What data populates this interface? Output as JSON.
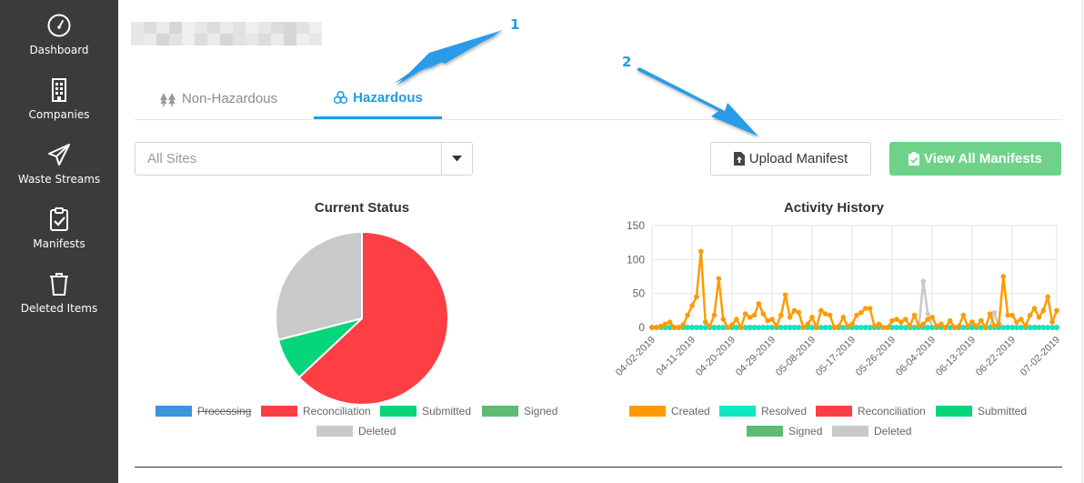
{
  "sidebar": {
    "items": [
      {
        "label": "Dashboard",
        "icon": "dashboard-gauge-icon"
      },
      {
        "label": "Companies",
        "icon": "building-icon"
      },
      {
        "label": "Waste Streams",
        "icon": "paper-plane-icon"
      },
      {
        "label": "Manifests",
        "icon": "clipboard-check-icon"
      },
      {
        "label": "Deleted Items",
        "icon": "trash-icon"
      }
    ]
  },
  "tabs": [
    {
      "label": "Non-Hazardous",
      "icon": "trees-icon",
      "active": false
    },
    {
      "label": "Hazardous",
      "icon": "biohazard-icon",
      "active": true
    }
  ],
  "site_filter": {
    "value": "All Sites"
  },
  "buttons": {
    "upload_label": "Upload Manifest",
    "view_all_label": "View All Manifests"
  },
  "annotations": {
    "one": "1",
    "two": "2"
  },
  "colors": {
    "accent": "#1b9ce3",
    "sidebar": "#3b3b3b",
    "view_button": "#6ed389",
    "processing": "#3d93dc",
    "reconciliation": "#fe3e45",
    "submitted": "#07d57a",
    "signed": "#5cbc72",
    "deleted": "#c9c9c9",
    "created": "#ff9b00",
    "resolved": "#0fe6c2"
  },
  "chart_data": [
    {
      "type": "pie",
      "title": "Current Status",
      "legend": [
        "Processing",
        "Reconciliation",
        "Submitted",
        "Signed",
        "Deleted"
      ],
      "legend_hidden": [
        "Processing"
      ],
      "values": [
        0,
        63,
        8,
        0,
        29
      ],
      "colors": [
        "#3d93dc",
        "#fe3e45",
        "#07d57a",
        "#5cbc72",
        "#c9c9c9"
      ],
      "legend_position": "bottom"
    },
    {
      "type": "line",
      "title": "Activity History",
      "ylim": [
        0,
        150
      ],
      "y_ticks": [
        0,
        50,
        100,
        150
      ],
      "x_tick_labels": [
        "04-02-2019",
        "04-11-2019",
        "04-20-2019",
        "04-29-2019",
        "05-08-2019",
        "05-17-2019",
        "05-26-2019",
        "06-04-2019",
        "06-13-2019",
        "06-22-2019",
        "07-02-2019"
      ],
      "x": [
        "04-02-2019",
        "04-03-2019",
        "04-04-2019",
        "04-05-2019",
        "04-06-2019",
        "04-07-2019",
        "04-08-2019",
        "04-09-2019",
        "04-10-2019",
        "04-11-2019",
        "04-12-2019",
        "04-13-2019",
        "04-14-2019",
        "04-15-2019",
        "04-16-2019",
        "04-17-2019",
        "04-18-2019",
        "04-19-2019",
        "04-20-2019",
        "04-21-2019",
        "04-22-2019",
        "04-23-2019",
        "04-24-2019",
        "04-25-2019",
        "04-26-2019",
        "04-27-2019",
        "04-28-2019",
        "04-29-2019",
        "04-30-2019",
        "05-01-2019",
        "05-02-2019",
        "05-03-2019",
        "05-04-2019",
        "05-05-2019",
        "05-06-2019",
        "05-07-2019",
        "05-08-2019",
        "05-09-2019",
        "05-10-2019",
        "05-11-2019",
        "05-12-2019",
        "05-13-2019",
        "05-14-2019",
        "05-15-2019",
        "05-16-2019",
        "05-17-2019",
        "05-18-2019",
        "05-19-2019",
        "05-20-2019",
        "05-21-2019",
        "05-22-2019",
        "05-23-2019",
        "05-24-2019",
        "05-25-2019",
        "05-26-2019",
        "05-27-2019",
        "05-28-2019",
        "05-29-2019",
        "05-30-2019",
        "05-31-2019",
        "06-01-2019",
        "06-02-2019",
        "06-03-2019",
        "06-04-2019",
        "06-05-2019",
        "06-06-2019",
        "06-07-2019",
        "06-08-2019",
        "06-09-2019",
        "06-10-2019",
        "06-11-2019",
        "06-12-2019",
        "06-13-2019",
        "06-14-2019",
        "06-15-2019",
        "06-16-2019",
        "06-17-2019",
        "06-18-2019",
        "06-19-2019",
        "06-20-2019",
        "06-21-2019",
        "06-22-2019",
        "06-23-2019",
        "06-24-2019",
        "06-25-2019",
        "06-26-2019",
        "06-27-2019",
        "06-28-2019",
        "06-29-2019",
        "06-30-2019",
        "07-01-2019",
        "07-02-2019"
      ],
      "series": [
        {
          "name": "Created",
          "color": "#ff9b00",
          "values": [
            0,
            0,
            2,
            5,
            8,
            0,
            0,
            4,
            18,
            32,
            45,
            112,
            8,
            2,
            18,
            72,
            12,
            0,
            4,
            12,
            0,
            20,
            15,
            18,
            35,
            20,
            10,
            12,
            2,
            18,
            48,
            15,
            25,
            22,
            0,
            5,
            15,
            0,
            25,
            20,
            18,
            0,
            2,
            15,
            2,
            5,
            18,
            22,
            28,
            28,
            2,
            5,
            0,
            0,
            10,
            12,
            8,
            12,
            2,
            18,
            2,
            5,
            12,
            15,
            2,
            5,
            0,
            10,
            0,
            2,
            18,
            2,
            8,
            2,
            10,
            0,
            20,
            2,
            5,
            75,
            18,
            18,
            8,
            12,
            2,
            18,
            28,
            15,
            25,
            45,
            8,
            25
          ]
        },
        {
          "name": "Resolved",
          "color": "#0fe6c2",
          "values": [
            0,
            0,
            0,
            0,
            0,
            0,
            0,
            0,
            0,
            0,
            0,
            0,
            0,
            0,
            0,
            0,
            0,
            0,
            0,
            0,
            0,
            0,
            0,
            0,
            0,
            0,
            0,
            0,
            0,
            0,
            0,
            0,
            0,
            0,
            0,
            0,
            0,
            0,
            0,
            0,
            0,
            0,
            0,
            0,
            0,
            0,
            0,
            0,
            0,
            0,
            0,
            0,
            0,
            0,
            0,
            0,
            0,
            0,
            0,
            0,
            0,
            0,
            0,
            0,
            0,
            0,
            0,
            0,
            0,
            0,
            0,
            0,
            0,
            0,
            0,
            0,
            0,
            0,
            0,
            0,
            0,
            0,
            0,
            0,
            0,
            0,
            0,
            0,
            0,
            0,
            0,
            0
          ]
        },
        {
          "name": "Reconciliation",
          "color": "#fe3e45",
          "values": [
            0,
            0,
            0,
            0,
            0,
            0,
            0,
            0,
            0,
            0,
            0,
            0,
            0,
            0,
            0,
            0,
            0,
            0,
            0,
            0,
            0,
            0,
            0,
            0,
            0,
            0,
            0,
            0,
            0,
            0,
            0,
            0,
            0,
            0,
            0,
            0,
            0,
            0,
            0,
            0,
            0,
            0,
            0,
            0,
            0,
            0,
            0,
            0,
            0,
            0,
            0,
            0,
            0,
            0,
            0,
            0,
            0,
            0,
            0,
            0,
            0,
            0,
            0,
            0,
            0,
            0,
            0,
            0,
            0,
            0,
            0,
            0,
            0,
            0,
            0,
            0,
            0,
            0,
            0,
            0,
            0,
            0,
            0,
            0,
            0,
            0,
            0,
            0,
            0,
            0,
            0,
            0
          ]
        },
        {
          "name": "Submitted",
          "color": "#07d57a",
          "values": [
            0,
            0,
            0,
            0,
            0,
            0,
            0,
            0,
            0,
            0,
            0,
            0,
            0,
            0,
            0,
            0,
            0,
            0,
            0,
            0,
            0,
            0,
            0,
            0,
            0,
            0,
            0,
            0,
            0,
            0,
            0,
            0,
            0,
            0,
            0,
            0,
            0,
            0,
            0,
            0,
            0,
            0,
            0,
            0,
            0,
            0,
            0,
            0,
            0,
            0,
            0,
            0,
            0,
            0,
            0,
            0,
            0,
            0,
            0,
            0,
            0,
            0,
            0,
            0,
            0,
            0,
            0,
            0,
            0,
            0,
            0,
            0,
            0,
            0,
            0,
            0,
            0,
            0,
            0,
            0,
            0,
            0,
            0,
            0,
            0,
            0,
            0,
            0,
            0,
            0,
            0,
            0
          ]
        },
        {
          "name": "Signed",
          "color": "#5cbc72",
          "values": [
            0,
            0,
            0,
            0,
            0,
            0,
            0,
            0,
            0,
            0,
            0,
            0,
            0,
            0,
            0,
            0,
            0,
            0,
            0,
            0,
            0,
            0,
            0,
            0,
            0,
            0,
            0,
            0,
            0,
            0,
            0,
            0,
            0,
            0,
            0,
            0,
            0,
            0,
            0,
            0,
            0,
            0,
            0,
            0,
            0,
            0,
            0,
            0,
            0,
            0,
            0,
            0,
            0,
            0,
            0,
            0,
            0,
            0,
            0,
            0,
            0,
            0,
            0,
            0,
            0,
            0,
            0,
            0,
            0,
            0,
            0,
            0,
            0,
            0,
            0,
            0,
            0,
            0,
            0,
            0,
            0,
            0,
            0,
            0,
            0,
            0,
            0,
            0,
            0,
            0,
            0,
            0
          ]
        },
        {
          "name": "Deleted",
          "color": "#c9c9c9",
          "values": [
            0,
            0,
            0,
            0,
            0,
            0,
            0,
            0,
            0,
            0,
            0,
            0,
            0,
            0,
            0,
            0,
            0,
            0,
            0,
            0,
            0,
            0,
            0,
            0,
            0,
            0,
            0,
            0,
            0,
            0,
            0,
            0,
            0,
            0,
            0,
            0,
            0,
            0,
            0,
            0,
            0,
            0,
            0,
            0,
            0,
            0,
            0,
            0,
            0,
            0,
            0,
            0,
            0,
            0,
            0,
            0,
            0,
            0,
            0,
            0,
            0,
            68,
            20,
            0,
            0,
            0,
            0,
            0,
            0,
            0,
            0,
            0,
            0,
            0,
            0,
            0,
            0,
            22,
            0,
            0,
            0,
            0,
            0,
            0,
            0,
            0,
            0,
            0,
            0,
            0,
            0,
            0
          ]
        }
      ],
      "grid": true,
      "legend_position": "bottom"
    }
  ]
}
